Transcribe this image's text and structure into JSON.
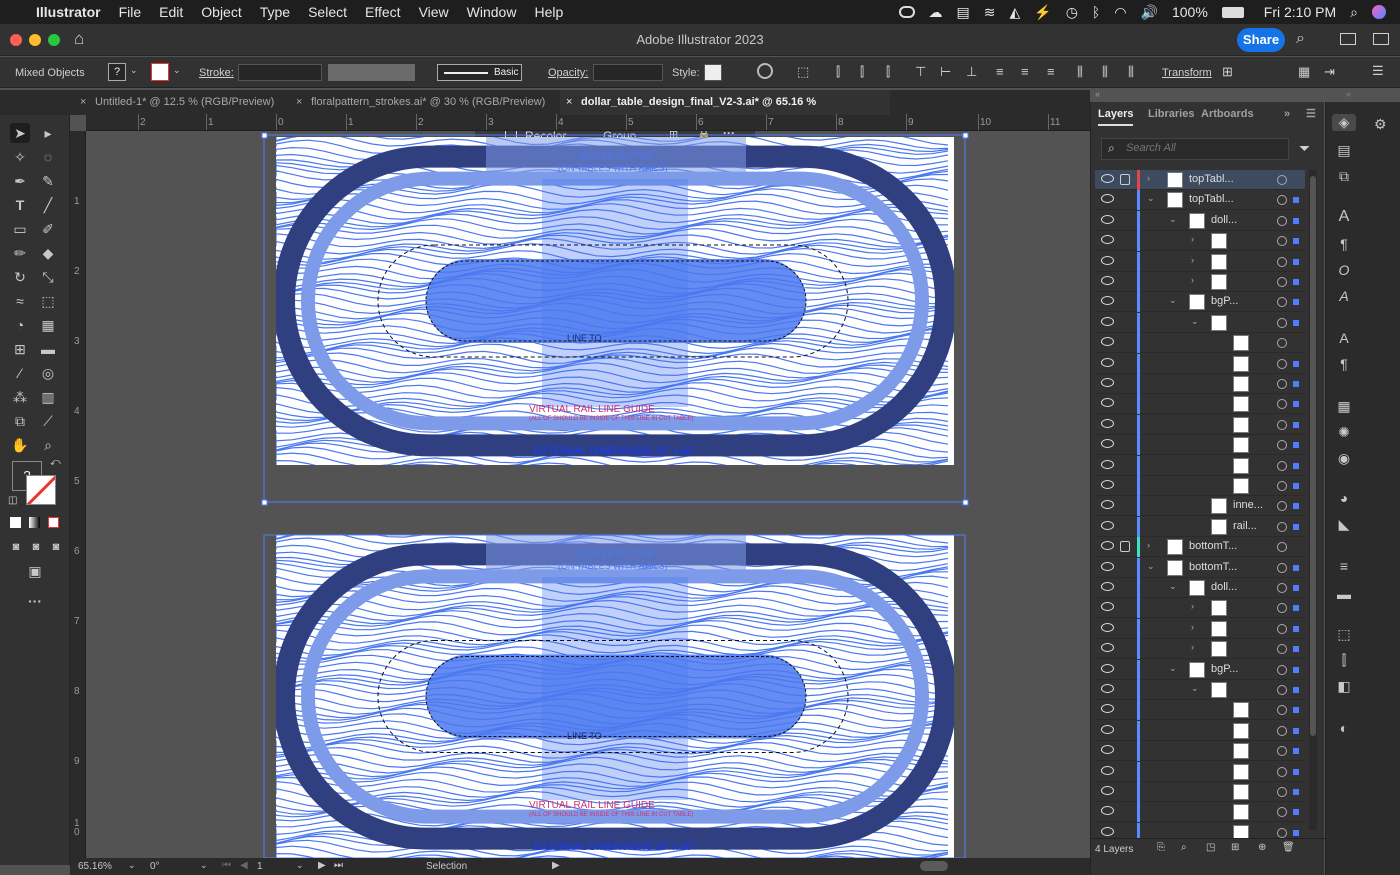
{
  "menubar": {
    "apple": "",
    "app": "Illustrator",
    "items": [
      "File",
      "Edit",
      "Object",
      "Type",
      "Select",
      "Effect",
      "View",
      "Window",
      "Help"
    ],
    "battery": "100%",
    "clock": "Fri 2:10 PM"
  },
  "titlebar": {
    "title": "Adobe Illustrator 2023",
    "share_label": "Share"
  },
  "control": {
    "selection_type": "Mixed Objects",
    "fill_value": "?",
    "stroke_label": "Stroke:",
    "brush_label": "Basic",
    "opacity_label": "Opacity:",
    "style_label": "Style:",
    "transform_label": "Transform"
  },
  "tabs": [
    {
      "label": "Untitled-1* @ 12.5 % (RGB/Preview)",
      "active": false
    },
    {
      "label": "floralpattern_strokes.ai* @ 30 % (RGB/Preview)",
      "active": false
    },
    {
      "label": "dollar_table_design_final_V2-3.ai* @ 65.16 % (RGB/Preview)",
      "active": true
    }
  ],
  "ruler_h": [
    "2",
    "1",
    "0",
    "1",
    "2",
    "3",
    "4",
    "5",
    "6",
    "7",
    "8",
    "9",
    "10",
    "11"
  ],
  "ruler_v": [
    "1",
    "2",
    "3",
    "4",
    "5",
    "6",
    "7",
    "8",
    "9",
    "1\n0"
  ],
  "canvas": {
    "context_recolor": "Recolor",
    "context_group": "Group",
    "art": {
      "line_color": "#4a78f0",
      "dark_band": "#2f3f80",
      "texts": {
        "top_center_1": "DEALER BUTTON",
        "top_center_2": "(ON TABLES WITH RAILS)",
        "line_to": "LINE TO",
        "rail_guide": "VIRTUAL RAIL LINE GUIDE",
        "rail_guide_sub": "(ALL OF SHOULD BE INSIDE OF THIS LINE IN CUT TABLE)",
        "external": "EXTERNAL DIMENSIONS 16\" x 36\""
      }
    }
  },
  "status": {
    "zoom": "65.16%",
    "rotation": "0°",
    "artboard": "1",
    "tool": "Selection"
  },
  "panel": {
    "tabs": [
      "Layers",
      "Libraries",
      "Artboards"
    ],
    "search_placeholder": "Search All",
    "footer": "4 Layers",
    "layers": [
      {
        "name": "topTabl...",
        "indent": 0,
        "lock": true,
        "tri": "›",
        "barColor": "#e4454a",
        "selected": true
      },
      {
        "name": "topTabl...",
        "indent": 0,
        "lock": false,
        "tri": "⌄",
        "barColor": "#5b8cff"
      },
      {
        "name": "doll...",
        "indent": 1,
        "lock": false,
        "tri": "⌄",
        "barColor": "#5b8cff"
      },
      {
        "name": "",
        "indent": 2,
        "lock": false,
        "tri": "›",
        "barColor": "#5b8cff"
      },
      {
        "name": "",
        "indent": 2,
        "lock": false,
        "tri": "›",
        "barColor": "#5b8cff"
      },
      {
        "name": "",
        "indent": 2,
        "lock": false,
        "tri": "›",
        "barColor": "#5b8cff"
      },
      {
        "name": "bgP...",
        "indent": 1,
        "lock": false,
        "tri": "⌄",
        "barColor": "#5b8cff"
      },
      {
        "name": "",
        "indent": 2,
        "lock": false,
        "tri": "⌄",
        "barColor": "#5b8cff"
      },
      {
        "name": "",
        "indent": 3,
        "lock": false,
        "tri": "",
        "barColor": "#5b8cff"
      },
      {
        "name": "",
        "indent": 3,
        "lock": false,
        "tri": "",
        "barColor": "#5b8cff"
      },
      {
        "name": "",
        "indent": 3,
        "lock": false,
        "tri": "",
        "barColor": "#5b8cff"
      },
      {
        "name": "",
        "indent": 3,
        "lock": false,
        "tri": "",
        "barColor": "#5b8cff"
      },
      {
        "name": "",
        "indent": 3,
        "lock": false,
        "tri": "",
        "barColor": "#5b8cff"
      },
      {
        "name": "",
        "indent": 3,
        "lock": false,
        "tri": "",
        "barColor": "#5b8cff"
      },
      {
        "name": "",
        "indent": 3,
        "lock": false,
        "tri": "",
        "barColor": "#5b8cff"
      },
      {
        "name": "",
        "indent": 3,
        "lock": false,
        "tri": "",
        "barColor": "#5b8cff"
      },
      {
        "name": "inne...",
        "indent": 2,
        "lock": false,
        "tri": "",
        "barColor": "#5b8cff"
      },
      {
        "name": "rail...",
        "indent": 2,
        "lock": false,
        "tri": "",
        "barColor": "#5b8cff"
      },
      {
        "name": "bottomT...",
        "indent": 0,
        "lock": true,
        "tri": "›",
        "barColor": "#3fe0c8"
      },
      {
        "name": "bottomT...",
        "indent": 0,
        "lock": false,
        "tri": "⌄",
        "barColor": "#5b8cff"
      },
      {
        "name": "doll...",
        "indent": 1,
        "lock": false,
        "tri": "⌄",
        "barColor": "#5b8cff"
      },
      {
        "name": "",
        "indent": 2,
        "lock": false,
        "tri": "›",
        "barColor": "#5b8cff"
      },
      {
        "name": "",
        "indent": 2,
        "lock": false,
        "tri": "›",
        "barColor": "#5b8cff"
      },
      {
        "name": "",
        "indent": 2,
        "lock": false,
        "tri": "›",
        "barColor": "#5b8cff"
      },
      {
        "name": "bgP...",
        "indent": 1,
        "lock": false,
        "tri": "⌄",
        "barColor": "#5b8cff"
      },
      {
        "name": "",
        "indent": 2,
        "lock": false,
        "tri": "⌄",
        "barColor": "#5b8cff"
      },
      {
        "name": "",
        "indent": 3,
        "lock": false,
        "tri": "",
        "barColor": "#5b8cff"
      },
      {
        "name": "",
        "indent": 3,
        "lock": false,
        "tri": "",
        "barColor": "#5b8cff"
      },
      {
        "name": "",
        "indent": 3,
        "lock": false,
        "tri": "",
        "barColor": "#5b8cff"
      },
      {
        "name": "",
        "indent": 3,
        "lock": false,
        "tri": "",
        "barColor": "#5b8cff"
      },
      {
        "name": "",
        "indent": 3,
        "lock": false,
        "tri": "",
        "barColor": "#5b8cff"
      },
      {
        "name": "",
        "indent": 3,
        "lock": false,
        "tri": "",
        "barColor": "#5b8cff"
      },
      {
        "name": "",
        "indent": 3,
        "lock": false,
        "tri": "",
        "barColor": "#5b8cff"
      }
    ]
  }
}
